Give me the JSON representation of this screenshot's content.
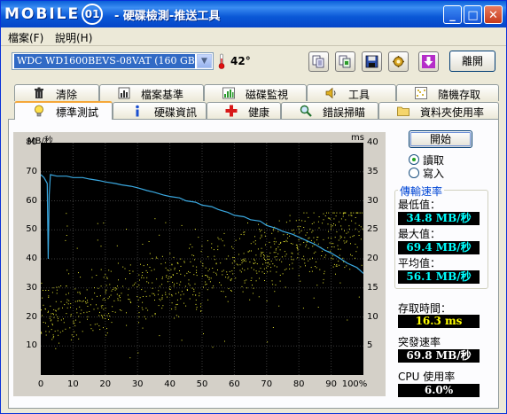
{
  "title_bar": {
    "logo_text": "MOBILE",
    "logo_mark": "01",
    "title": "- 硬碟檢測-推送工具",
    "minimize": "_",
    "maximize": "□",
    "close": "✕"
  },
  "menu": {
    "file": "檔案(F)",
    "help": "說明(H)"
  },
  "toolbar": {
    "drive_selected": "WDC WD1600BEVS-08VAT (160 GB)",
    "temperature": "42°",
    "exit_label": "離開",
    "icons": [
      "copy-text-icon",
      "copy-screenshot-icon",
      "save-icon",
      "settings-icon",
      "download-icon"
    ]
  },
  "tabs_row1": [
    {
      "label": "清除",
      "icon": "trash-icon"
    },
    {
      "label": "檔案基準",
      "icon": "file-benchmark-icon"
    },
    {
      "label": "磁碟監視",
      "icon": "disk-monitor-icon"
    },
    {
      "label": "工具",
      "icon": "speaker-icon"
    },
    {
      "label": "隨機存取",
      "icon": "random-access-icon"
    }
  ],
  "tabs_row2": [
    {
      "label": "標準測試",
      "icon": "bulb-icon",
      "active": true
    },
    {
      "label": "硬碟資訊",
      "icon": "info-icon"
    },
    {
      "label": "健康",
      "icon": "health-cross-icon"
    },
    {
      "label": "錯誤掃瞄",
      "icon": "magnifier-icon"
    },
    {
      "label": "資料夾使用率",
      "icon": "folder-icon"
    }
  ],
  "controls": {
    "start_label": "開始",
    "read_label": "讀取",
    "write_label": "寫入",
    "mode": "read"
  },
  "results": {
    "group_title": "傳輸速率",
    "min_label": "最低值：",
    "min_value": "34.8 MB/秒",
    "max_label": "最大值：",
    "max_value": "69.4 MB/秒",
    "avg_label": "平均值：",
    "avg_value": "56.1 MB/秒",
    "access_label": "存取時間：",
    "access_value": "16.3 ms",
    "burst_label": "突發速率",
    "burst_value": "69.8 MB/秒",
    "cpu_label": "CPU 使用率",
    "cpu_value": "6.0%"
  },
  "chart_data": {
    "type": "line",
    "ylabel_left": "MB/秒",
    "ylabel_right": "ms",
    "x_ticks": [
      "0",
      "10",
      "20",
      "30",
      "40",
      "50",
      "60",
      "70",
      "80",
      "90",
      "100%"
    ],
    "y_left_ticks": [
      "80",
      "70",
      "60",
      "50",
      "40",
      "30",
      "20",
      "10"
    ],
    "y_right_ticks": [
      "40",
      "35",
      "30",
      "25",
      "20",
      "15",
      "10",
      "5"
    ],
    "xlim": [
      0,
      100
    ],
    "ylim_left": [
      0,
      80
    ],
    "ylim_right": [
      0,
      40
    ],
    "transfer_color": "#3aa8e0",
    "access_color": "#e8e830",
    "transfer_series": {
      "x": [
        0,
        1,
        2,
        2.3,
        2.6,
        3,
        5,
        8,
        10,
        13,
        15,
        18,
        20,
        23,
        25,
        28,
        30,
        33,
        35,
        38,
        40,
        43,
        45,
        48,
        50,
        53,
        55,
        58,
        60,
        63,
        65,
        68,
        70,
        73,
        75,
        78,
        80,
        83,
        85,
        88,
        90,
        93,
        95,
        98,
        100
      ],
      "y": [
        69,
        68,
        66,
        40,
        62,
        69,
        68.5,
        68.5,
        68,
        68,
        67.5,
        67,
        66.5,
        66,
        65.5,
        65,
        64.5,
        63.5,
        63,
        62,
        61.5,
        61,
        60,
        59.5,
        58.5,
        58,
        57,
        56,
        55,
        54.5,
        53.5,
        53,
        51.5,
        50.5,
        49.5,
        48.5,
        47.5,
        46,
        45,
        43,
        42,
        40,
        38.5,
        37,
        35
      ]
    },
    "access_cloud": {
      "min_ms": 3,
      "max_ms": 28,
      "trend_start_ms": 10,
      "trend_end_ms": 25,
      "point_count": 900
    }
  }
}
